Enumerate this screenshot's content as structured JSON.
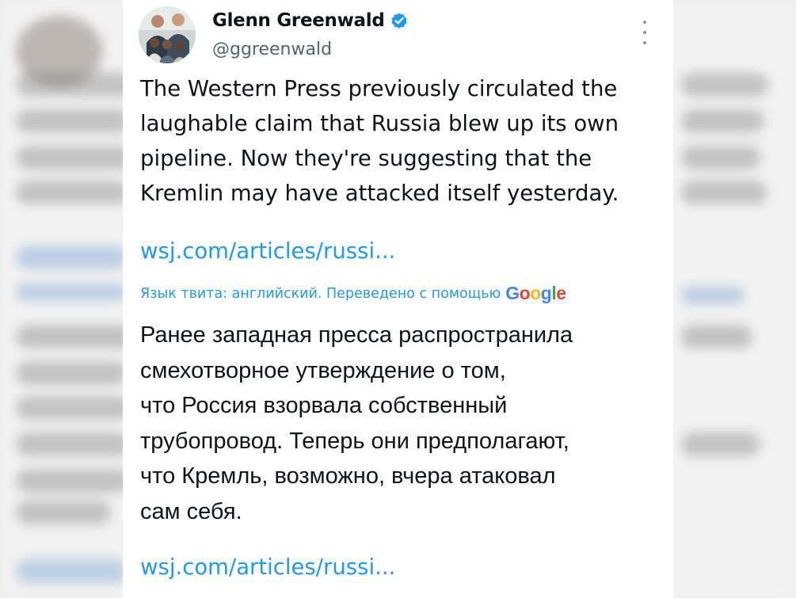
{
  "author": {
    "display_name": "Glenn Greenwald",
    "handle": "@ggreenwald",
    "verified": true,
    "verified_icon": "verified-badge-icon",
    "avatar": "group-photo-avatar"
  },
  "menu": {
    "icon": "more-vertical-icon"
  },
  "tweet": {
    "text": "The Western Press previously circulated the\nlaughable claim that Russia blew up its own\npipeline. Now they're suggesting that the\nKremlin may have attacked itself yesterday.",
    "link": "wsj.com/articles/russi..."
  },
  "translation": {
    "note": "Язык твита: английский. Переведено с помощью",
    "provider": "Google",
    "provider_letters": [
      {
        "char": "G",
        "color": "#4285F4"
      },
      {
        "char": "o",
        "color": "#EA4335"
      },
      {
        "char": "o",
        "color": "#FBBC05"
      },
      {
        "char": "g",
        "color": "#4285F4"
      },
      {
        "char": "l",
        "color": "#34A853"
      },
      {
        "char": "e",
        "color": "#EA4335"
      }
    ],
    "text": "Ранее западная пресса распространила\nсмехотворное утверждение о том,\nчто Россия взорвала собственный\nтрубопровод. Теперь они предполагают,\nчто Кремль, возможно, вчера атаковал\nсам себя.",
    "link": "wsj.com/articles/russi..."
  },
  "colors": {
    "link": "#1d9bf0",
    "text": "#0f1419",
    "secondary": "#536471",
    "verified": "#1d9bf0"
  }
}
